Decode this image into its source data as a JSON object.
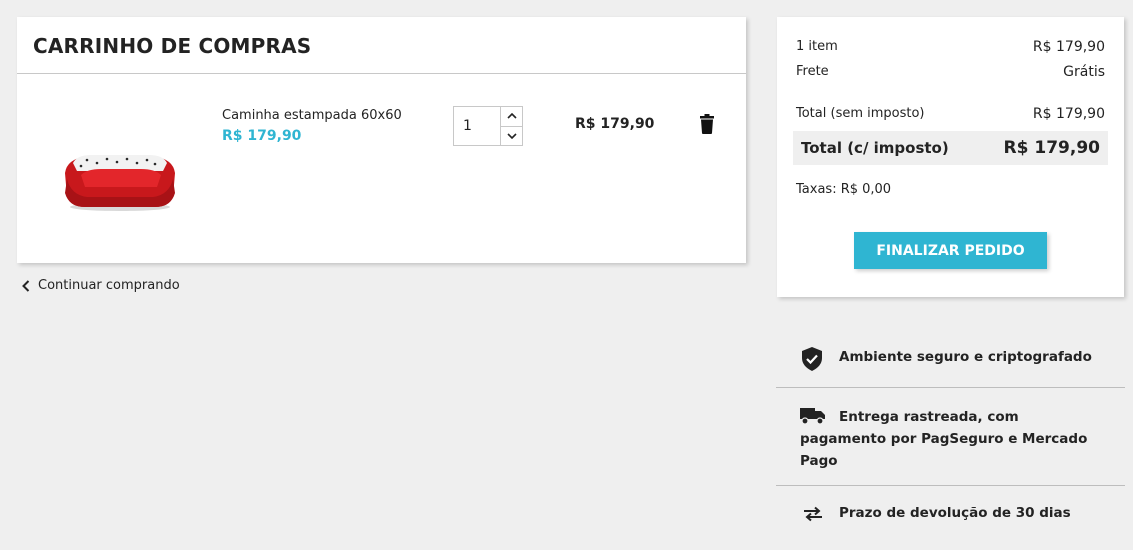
{
  "cart": {
    "title": "CARRINHO DE COMPRAS",
    "item": {
      "name": "Caminha estampada 60x60",
      "unit_price": "R$ 179,90",
      "quantity": "1",
      "line_total": "R$ 179,90"
    },
    "continue_label": "Continuar comprando"
  },
  "summary": {
    "items_label": "1 item",
    "items_value": "R$ 179,90",
    "shipping_label": "Frete",
    "shipping_value": "Grátis",
    "total_excl_label": "Total (sem imposto)",
    "total_excl_value": "R$ 179,90",
    "total_incl_label": "Total (c/ imposto)",
    "total_incl_value": "R$ 179,90",
    "taxes": "Taxas: R$ 0,00",
    "checkout_label": "FINALIZAR PEDIDO"
  },
  "reassurance": {
    "secure": "Ambiente seguro e criptografado",
    "delivery": "Entrega rastreada, com pagamento por PagSeguro e Mercado Pago",
    "returns": "Prazo de devolução de 30 dias"
  },
  "colors": {
    "accent": "#2fb5d2",
    "background": "#efefef",
    "text": "#232323"
  },
  "icons": [
    "chevron-left-icon",
    "chevron-up-icon",
    "chevron-down-icon",
    "trash-icon",
    "shield-check-icon",
    "truck-icon",
    "swap-arrows-icon"
  ]
}
